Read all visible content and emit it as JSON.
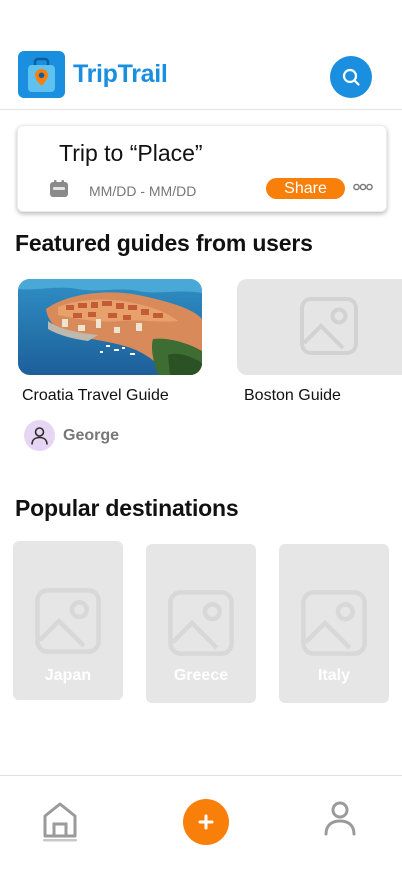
{
  "header": {
    "app_title": "TripTrail",
    "logo_icon": "travel-bag-pin-icon",
    "search_icon": "search-icon",
    "brand_color": "#1a8fe0"
  },
  "trip_card": {
    "title": "Trip to “Place”",
    "dates": "MM/DD - MM/DD",
    "calendar_icon": "calendar-icon",
    "share_label": "Share",
    "more_icon": "more-options-icon",
    "accent_color": "#f97f0b"
  },
  "featured": {
    "section_title": "Featured guides from users",
    "guides": [
      {
        "label": "Croatia Travel Guide",
        "image": "dubrovnik-coastline-photo",
        "author": "George"
      },
      {
        "label": "Boston Guide",
        "image": "image-placeholder-icon"
      }
    ]
  },
  "destinations": {
    "section_title": "Popular destinations",
    "items": [
      {
        "label": "Japan"
      },
      {
        "label": "Greece"
      },
      {
        "label": "Italy"
      }
    ]
  },
  "bottom_nav": {
    "items": [
      {
        "icon": "home-icon"
      },
      {
        "icon": "plus-icon"
      },
      {
        "icon": "profile-icon"
      }
    ]
  }
}
